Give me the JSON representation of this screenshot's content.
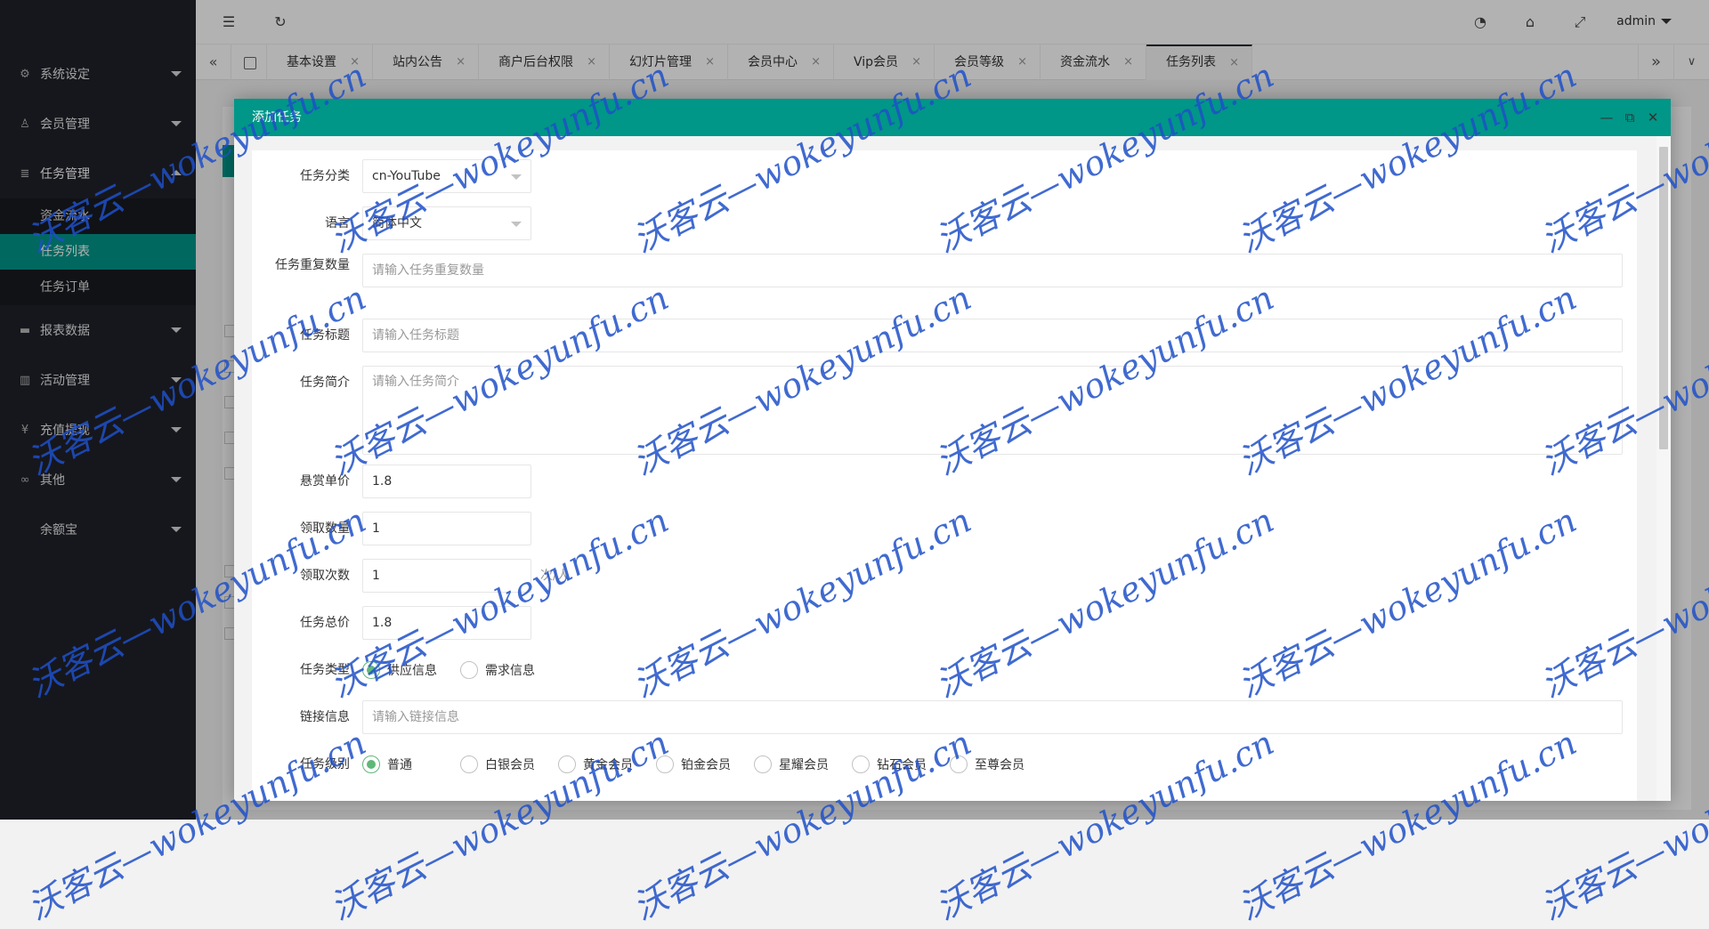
{
  "sidebar": {
    "items": [
      {
        "label": "系统设定",
        "icon": "gear-icon"
      },
      {
        "label": "会员管理",
        "icon": "user-icon"
      },
      {
        "label": "任务管理",
        "icon": "list-icon"
      },
      {
        "label": "报表数据",
        "icon": "report-icon"
      },
      {
        "label": "活动管理",
        "icon": "book-icon"
      },
      {
        "label": "充值提现",
        "icon": "yen-icon"
      },
      {
        "label": "其他",
        "icon": "infinity-icon"
      },
      {
        "label": "余额宝"
      }
    ],
    "sub_items": [
      "资金流水",
      "任务列表",
      "任务订单"
    ]
  },
  "header": {
    "user": "admin",
    "icons": [
      "menu-fold-icon",
      "refresh-icon",
      "theme-icon",
      "tag-icon",
      "fullscreen-icon"
    ]
  },
  "tabs": {
    "items": [
      "基本设置",
      "站内公告",
      "商户后台权限",
      "幻灯片管理",
      "会员中心",
      "Vip会员",
      "会员等级",
      "资金流水",
      "任务列表"
    ],
    "close_glyph": "×"
  },
  "modal": {
    "title": "添加任务",
    "fields": {
      "category": {
        "label": "任务分类",
        "value": "cn-YouTube"
      },
      "language": {
        "label": "语言",
        "value": "简体中文"
      },
      "repeat": {
        "label": "任务重复数量",
        "placeholder": "请输入任务重复数量"
      },
      "title": {
        "label": "任务标题",
        "placeholder": "请输入任务标题"
      },
      "intro": {
        "label": "任务简介",
        "placeholder": "请输入任务简介"
      },
      "reward": {
        "label": "悬赏单价",
        "value": "1.8"
      },
      "claim_qty": {
        "label": "领取数量",
        "value": "1"
      },
      "claim_times": {
        "label": "领取次数",
        "value": "1",
        "suffix": "次/人"
      },
      "total": {
        "label": "任务总价",
        "value": "1.8"
      },
      "type": {
        "label": "任务类型",
        "options": [
          "供应信息",
          "需求信息"
        ],
        "selected": "供应信息"
      },
      "link": {
        "label": "链接信息",
        "placeholder": "请输入链接信息"
      },
      "level": {
        "label": "任务级别",
        "options": [
          "普通",
          "白银会员",
          "黄金会员",
          "铂金会员",
          "星耀会员",
          "钻石会员",
          "至尊会员"
        ],
        "selected": "普通"
      }
    }
  },
  "watermark": "沃客云—wokeyunfu.cn"
}
